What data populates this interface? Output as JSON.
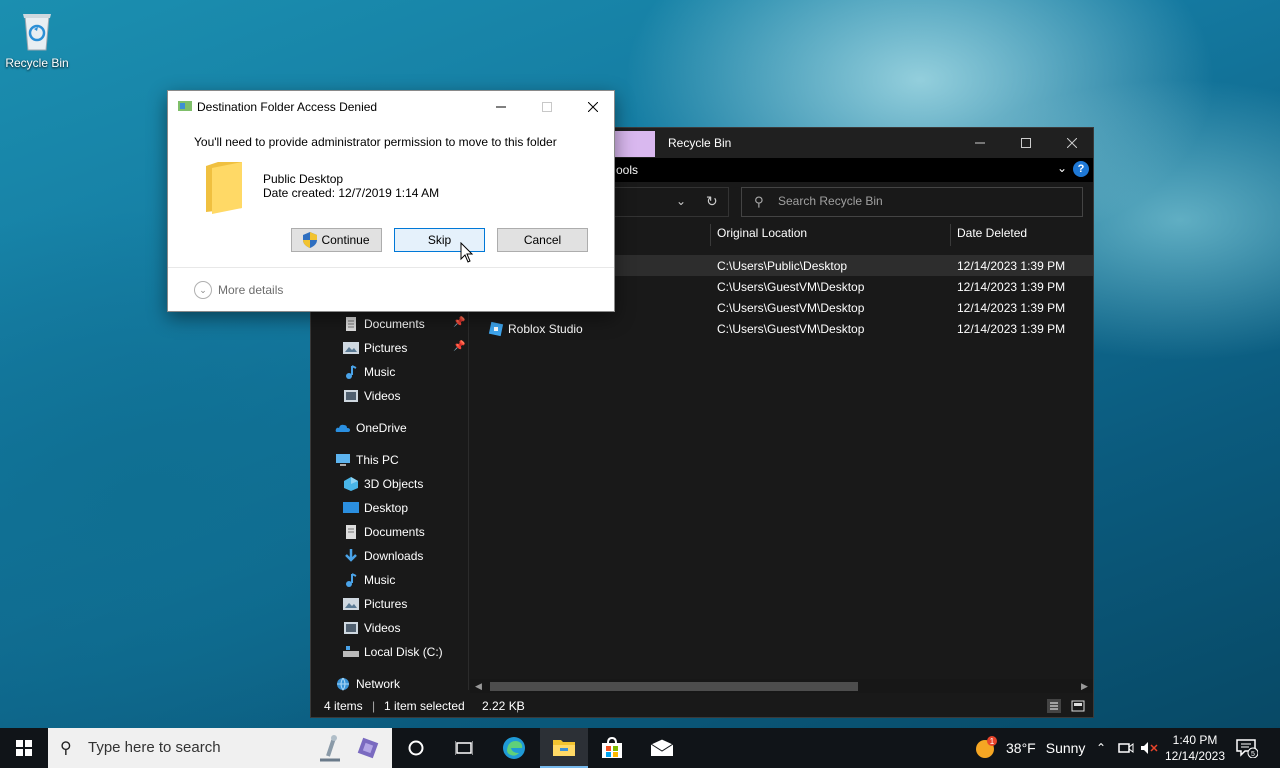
{
  "desktop": {
    "recycle_bin_label": "Recycle Bin"
  },
  "explorer": {
    "title": "Recycle Bin",
    "ribbon_tools": "ools",
    "search_placeholder": "Search Recycle Bin",
    "columns": {
      "original_location": "Original Location",
      "date_deleted": "Date Deleted"
    },
    "rows": [
      {
        "name": "",
        "location": "C:\\Users\\Public\\Desktop",
        "date": "12/14/2023 1:39 PM"
      },
      {
        "name": "",
        "location": "C:\\Users\\GuestVM\\Desktop",
        "date": "12/14/2023 1:39 PM"
      },
      {
        "name": "",
        "location": "C:\\Users\\GuestVM\\Desktop",
        "date": "12/14/2023 1:39 PM"
      },
      {
        "name": "Roblox Studio",
        "location": "C:\\Users\\GuestVM\\Desktop",
        "date": "12/14/2023 1:39 PM"
      }
    ],
    "nav": {
      "quick_access": [
        "Documents",
        "Pictures",
        "Music",
        "Videos"
      ],
      "onedrive": "OneDrive",
      "this_pc": "This PC",
      "pc_items": [
        "3D Objects",
        "Desktop",
        "Documents",
        "Downloads",
        "Music",
        "Pictures",
        "Videos",
        "Local Disk (C:)"
      ],
      "network": "Network"
    },
    "status": {
      "items": "4 items",
      "selected": "1 item selected",
      "size": "2.22 KB"
    }
  },
  "dialog": {
    "title": "Destination Folder Access Denied",
    "message": "You'll need to provide administrator permission to move to this folder",
    "folder_name": "Public Desktop",
    "date_created": "Date created: 12/7/2019 1:14 AM",
    "continue_label": "Continue",
    "skip_label": "Skip",
    "cancel_label": "Cancel",
    "more_details": "More details"
  },
  "taskbar": {
    "search_placeholder": "Type here to search",
    "weather_temp": "38°F",
    "weather_desc": "Sunny",
    "weather_badge": "1",
    "time": "1:40 PM",
    "date": "12/14/2023",
    "notification_count": "5"
  },
  "colors": {
    "accent": "#0078d7",
    "explorer_bg": "#191919",
    "taskbar_bg": "#101418"
  }
}
